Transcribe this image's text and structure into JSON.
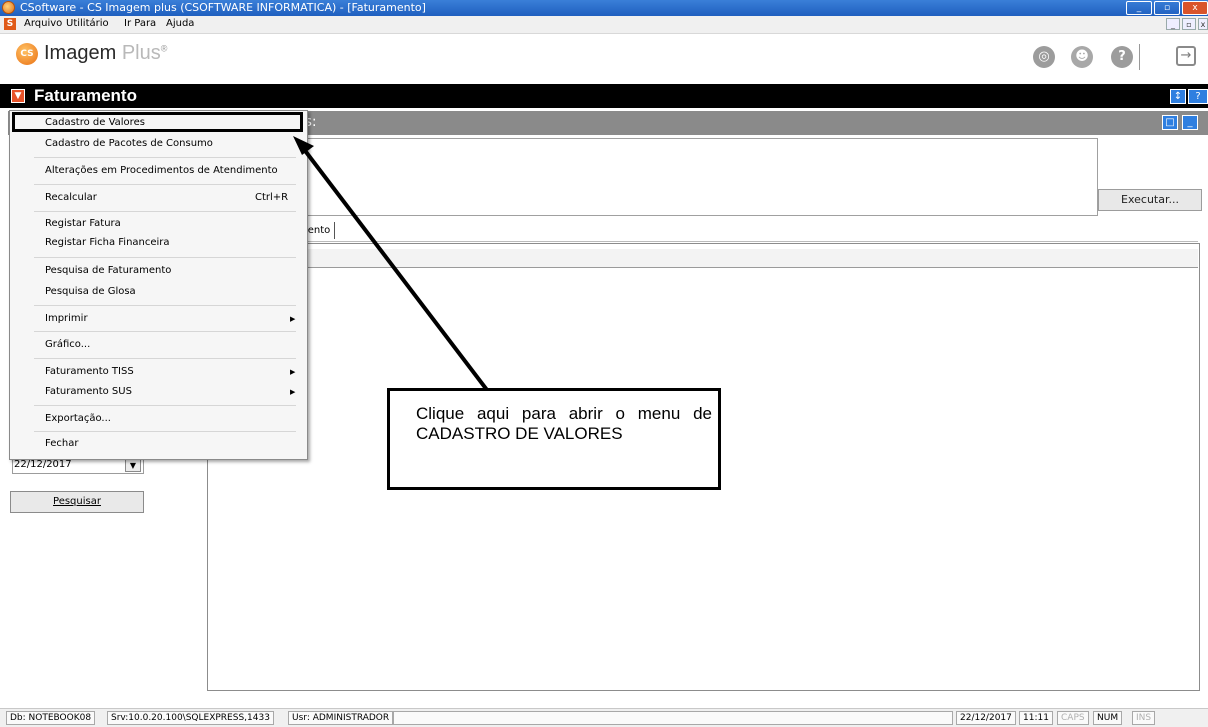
{
  "window": {
    "title": "CSoftware - CS Imagem plus (CSOFTWARE INFORMATICA) - [Faturamento]",
    "controls": [
      "_",
      "▫",
      "x"
    ]
  },
  "menubar": {
    "items": [
      "Arquivo",
      "Utilitário",
      "Ir Para",
      "Ajuda"
    ],
    "mdi_controls": [
      "_",
      "▫",
      "x"
    ]
  },
  "app_header": {
    "brand_logo_text": "CS",
    "brand_name": "Imagem",
    "brand_suffix": "Plus",
    "brand_mark": "®",
    "icons": [
      "globe-icon",
      "user-support-icon",
      "help-icon",
      "exit-icon"
    ]
  },
  "module": {
    "title": "Faturamento",
    "buttons": [
      "↕",
      "?"
    ]
  },
  "panel": {
    "header_text": "os:",
    "buttons": [
      "□",
      "_"
    ]
  },
  "execute_button": "Executar...",
  "tab_label": "mento",
  "date": {
    "value": "22/12/2017",
    "drop": "▼"
  },
  "search_button": "Pesquisar",
  "dropdown_menu": {
    "items": [
      {
        "label": "Cadastro de Valores",
        "shortcut": "",
        "submenu": false,
        "highlighted": true
      },
      {
        "label": "Cadastro de Pacotes de Consumo",
        "shortcut": "",
        "submenu": false
      },
      {
        "label": "Alterações em Procedimentos de Atendimento",
        "shortcut": "",
        "submenu": false
      },
      {
        "label": "Recalcular",
        "shortcut": "Ctrl+R",
        "submenu": false
      },
      {
        "label": "Registar Fatura",
        "shortcut": "",
        "submenu": false
      },
      {
        "label": "Registar Ficha Financeira",
        "shortcut": "",
        "submenu": false
      },
      {
        "label": "Pesquisa de Faturamento",
        "shortcut": "",
        "submenu": false
      },
      {
        "label": "Pesquisa de Glosa",
        "shortcut": "",
        "submenu": false
      },
      {
        "label": "Imprimir",
        "shortcut": "",
        "submenu": true
      },
      {
        "label": "Gráfico...",
        "shortcut": "",
        "submenu": false
      },
      {
        "label": "Faturamento TISS",
        "shortcut": "",
        "submenu": true
      },
      {
        "label": "Faturamento SUS",
        "shortcut": "",
        "submenu": true
      },
      {
        "label": "Exportação...",
        "shortcut": "",
        "submenu": false
      },
      {
        "label": "Fechar",
        "shortcut": "",
        "submenu": false
      }
    ],
    "submenu_arrow": "▶"
  },
  "callout": {
    "text": "Clique aqui para abrir o menu de CADASTRO DE VALORES"
  },
  "status_bar": {
    "db": "Db: NOTEBOOK08",
    "srv": "Srv:10.0.20.100\\SQLEXPRESS,1433",
    "usr": "Usr: ADMINISTRADOR",
    "date": "22/12/2017",
    "time": "11:11",
    "caps": "CAPS",
    "num": "NUM",
    "ins": "INS"
  },
  "colors": {
    "titlebar": "#1f5fbf",
    "module_bar": "#000000",
    "panel_header": "#8a8a8a",
    "accent_orange": "#e96f12",
    "module_button_blue": "#2f7fe0"
  }
}
